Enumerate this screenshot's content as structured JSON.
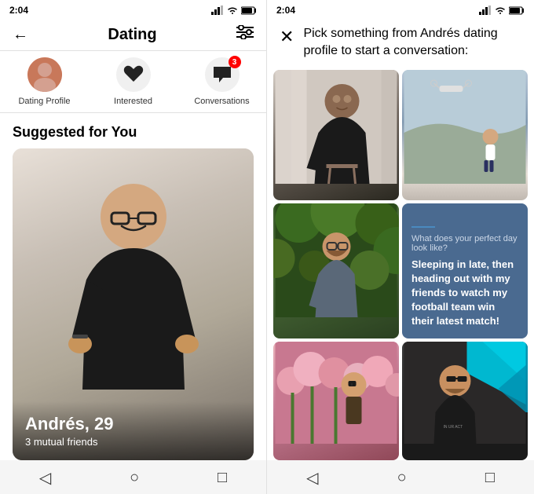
{
  "left": {
    "status_bar": {
      "time": "2:04",
      "signal": "▲▲▲",
      "wifi": "WiFi",
      "battery": "🔋"
    },
    "header": {
      "back_label": "←",
      "title": "Dating",
      "filter_label": "⚙"
    },
    "nav_tabs": [
      {
        "id": "dating-profile",
        "label": "Dating Profile",
        "icon_type": "avatar",
        "badge": null
      },
      {
        "id": "interested",
        "label": "Interested",
        "icon_type": "heart",
        "badge": null
      },
      {
        "id": "conversations",
        "label": "Conversations",
        "icon_type": "chat",
        "badge": "3"
      }
    ],
    "section_title": "Suggested for You",
    "profile": {
      "name": "Andrés, 29",
      "mutual_friends": "3 mutual friends"
    },
    "bottom_nav": {
      "back": "◁",
      "home": "○",
      "square": "□"
    }
  },
  "right": {
    "status_bar": {
      "time": "2:04"
    },
    "header": {
      "close_label": "✕",
      "text": "Pick something from Andrés dating profile to start a conversation:"
    },
    "photos": [
      {
        "id": "photo-1",
        "type": "person-dark",
        "alt": "Andrés sitting"
      },
      {
        "id": "photo-2",
        "type": "drone-person",
        "alt": "Person with drone"
      },
      {
        "id": "photo-3",
        "type": "garden-person",
        "alt": "Andrés in garden"
      },
      {
        "id": "photo-4",
        "type": "text-card",
        "question": "What does your perfect day look like?",
        "answer": "Sleeping in late, then heading out with my friends to watch my football team win their latest match!"
      },
      {
        "id": "photo-5",
        "type": "flowers-person",
        "alt": "Andrés with flowers"
      },
      {
        "id": "photo-6",
        "type": "dark-colorful",
        "alt": "Andrés with colorful wall"
      }
    ],
    "bottom_nav": {
      "back": "◁",
      "home": "○",
      "square": "□"
    }
  }
}
